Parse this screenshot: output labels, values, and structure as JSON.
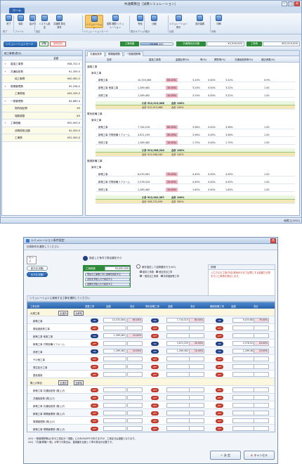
{
  "win1": {
    "title": "共通費算出［試算シミュレーション］",
    "app_tab": "ホーム",
    "ribbon": [
      {
        "label": "終了",
        "icon": "exit-icon"
      },
      {
        "label": "保存",
        "icon": "save-icon"
      },
      {
        "label": "会計事",
        "icon": "accounting-icon"
      },
      {
        "label": "システム設定",
        "icon": "system-settings-icon"
      },
      {
        "label": "共通費\n算出条件",
        "icon": "calc-condition-icon"
      },
      {
        "label": "シミュレーション",
        "icon": "simulation-icon"
      },
      {
        "label": "逆算 期間\nシミュレーション",
        "icon": "reverse-sim-icon"
      },
      {
        "label": "有効",
        "icon": "valid-icon"
      },
      {
        "label": "比較",
        "icon": "compare-icon"
      },
      {
        "label": "シミュレーション条件",
        "icon": "sim-condition-icon"
      },
      {
        "label": "前計金額",
        "icon": "prev-amount-icon"
      },
      {
        "label": "印刷",
        "icon": "print-icon"
      }
    ],
    "ribbon_groups": [
      "終了",
      "ファイル",
      "設定",
      "シミュレーションモード",
      "表示オプション",
      "表示",
      "比較",
      "印刷"
    ],
    "sim_mode_btn": "シミュレーションモード",
    "status_tag1": "試験",
    "status_tag2": "全体合計",
    "labels": {
      "construction": "工事総額",
      "total_common": "共通費総合計額",
      "work_cost": "工事費"
    },
    "values": {
      "construction": "50,000,000",
      "total_common": "¥2,500,000",
      "work_cost": "¥52,510,000"
    },
    "progress_fraction": 0.55,
    "left_title": "総工事費(表示)",
    "left_head": {
      "name": "",
      "amount": "金額"
    },
    "left_rows": [
      {
        "name": "直接工事費",
        "amount": "¥38,722,5",
        "exp": "+",
        "sub": false
      },
      {
        "name": "共通仮設費",
        "amount": "¥1,359,0",
        "exp": "+",
        "sub": false
      },
      {
        "name": "純工事費",
        "amount": "¥40,081,5",
        "exp": "",
        "sub": true
      },
      {
        "name": "現場管理費",
        "amount": "¥5,258,0",
        "exp": "+",
        "sub": false
      },
      {
        "name": "工事原価",
        "amount": "¥45,339,5",
        "exp": "",
        "sub": true
      },
      {
        "name": "一般管理費",
        "amount": "¥4,660,4",
        "exp": "+",
        "sub": false
      },
      {
        "name": "契約保証費",
        "amount": "¥0",
        "exp": "",
        "sub": true
      },
      {
        "name": "端数調整",
        "amount": "-¥0",
        "exp": "",
        "sub": true
      },
      {
        "name": "工事価格",
        "amount": "¥50,000,0",
        "exp": "+",
        "sub": false
      },
      {
        "name": "消費税相当額",
        "amount": "¥2,500,0",
        "exp": "",
        "sub": true
      },
      {
        "name": "工事費",
        "amount": "¥52,500,0",
        "exp": "",
        "sub": true
      }
    ],
    "right_tabs": [
      "共通仮設費",
      "現場管理費",
      "一般管理費等"
    ],
    "grid_headers": [
      "名称",
      "直接工事費",
      "金額比率(%)",
      "率(%)",
      "標準率(%)",
      "共通仮設費率(%)",
      "補正係数(%)"
    ],
    "sections": [
      {
        "title": "道路工事",
        "sub": "案本工事"
      },
      {
        "title": "電気設備工事",
        "sub": "案本工事"
      },
      {
        "title": "機械設備工事",
        "sub": "案本工事"
      }
    ],
    "rows": [
      {
        "name": "新築工事",
        "amount": "10,333,064",
        "ratio": "60.00%",
        "rate": "3.23%",
        "std": "0.00%",
        "common": "3.22%",
        "fix": "0.9%"
      },
      {
        "name": "新築工事 他事工事",
        "amount": "1,289,462",
        "ratio": "10.00%",
        "rate": "3.23%",
        "std": "0.00%",
        "common": "3.22%",
        "fix": "1.00"
      },
      {
        "name": "改修工事",
        "amount": "1,289,462",
        "ratio": "10.00%",
        "rate": "3.23%",
        "std": "0.00%",
        "common": "3.22%",
        "fix": "1.00"
      },
      {
        "name": "新築工事",
        "amount": "7,744,519",
        "ratio": "60.00%",
        "rate": "3.56%",
        "std": "0.00%",
        "common": "3.56%",
        "fix": "1.00"
      },
      {
        "name": "新築工事 付帯設備リフォーム",
        "amount": "3,872,259",
        "ratio": "30.00%",
        "rate": "3.56%",
        "std": "0.00%",
        "common": "3.56%",
        "fix": "1.00"
      },
      {
        "name": "改修工事",
        "amount": "1,289,462",
        "ratio": "10.00%",
        "rate": "1.75%",
        "std": "0.00%",
        "common": "1.75%",
        "fix": "1.00"
      },
      {
        "name": "新築工事",
        "amount": "8,033,061",
        "ratio": "70.00%",
        "rate": "4.45%",
        "std": "0.00%",
        "common": "4.45%",
        "fix": "1.00"
      },
      {
        "name": "新築工事 付帯設備リフォーム",
        "amount": "2,578,524",
        "ratio": "20.00%",
        "rate": "4.45%",
        "std": "0.00%",
        "common": "4.45%",
        "fix": "1.00"
      },
      {
        "name": "改修工事",
        "amount": "1,289,462",
        "ratio": "10.00%",
        "rate": "1.62%",
        "std": "0.00%",
        "common": "1.62%",
        "fix": "1.00"
      }
    ],
    "subtotals": [
      {
        "label": "小計",
        "amount": "¥12,913,988",
        "ratio": "合計 100%"
      },
      {
        "label": "小計",
        "amount": "¥12,906,240",
        "ratio": "合計 100%"
      },
      {
        "label": "小計",
        "amount": "¥12,902,367",
        "ratio": "合計 100%"
      }
    ],
    "totals": [
      {
        "label": "合計",
        "amount": "¥12,913,988",
        "ratio": "合計 100%"
      },
      {
        "label": "合計",
        "amount": "¥12,906,240",
        "ratio": "合計 100%"
      },
      {
        "label": "合計",
        "amount": "¥38,722,595",
        "ratio": "合計 300%"
      }
    ],
    "status_right": "総費工(2012)"
  },
  "win2": {
    "title": "シミュレーション条件設定",
    "subheader": "計算条件を選択してください",
    "mode_label": "モード",
    "mode_btns": [
      "施方法(試験)",
      "全方法(試験)"
    ],
    "instruction": "指定した条件で算出額を行う",
    "green_title": "工事総額",
    "green_value": "50,000,000",
    "opts": [
      "現在の工事費と同じ金額を指定する",
      "割合を手動入力で指定する",
      "金額を手動入力で指定する"
    ],
    "condition_label": "案を指定して逆算額を行う(※1)",
    "checks": [
      "基本工事費",
      "他社担当工事",
      "一般担当工事費",
      "共同施設等工事"
    ],
    "explain_title": "詳細",
    "explain_text": "入力された工事(予定)費用が今まで目標とする金額で計算を行い工事費を算出します。",
    "grid_label": "シミュレーションに使用する工事を選択してください",
    "grid_headers": [
      "工事名称",
      "道路工事",
      "金額",
      "割合",
      "電気設備工事",
      "金額",
      "割合",
      "機械設備工事",
      "金額",
      "割合"
    ],
    "grid_rows": [
      {
        "name": "大規工事",
        "cat": true,
        "p1": "",
        "a1": "",
        "r1": "",
        "p2": "",
        "a2": "",
        "r2": "",
        "p3": "",
        "a3": "",
        "r3": ""
      },
      {
        "name": "新築工事",
        "cat": false,
        "p1": "ON",
        "a1": "10,333,064",
        "r1": "60.00%",
        "p2": "ON",
        "a2": "7,744,519",
        "r2": "60.00%",
        "p3": "ON",
        "a3": "9,033,681",
        "r3": "70.00%"
      },
      {
        "name": "原仮施設費工事",
        "cat": false,
        "p1": "OFF",
        "a1": "",
        "r1": "",
        "p2": "OFF",
        "a2": "",
        "r2": "",
        "p3": "OFF",
        "a3": "",
        "r3": ""
      },
      {
        "name": "新築工事 他事工事",
        "cat": false,
        "p1": "ON",
        "a1": "1,289,462",
        "r1": "10.00%",
        "p2": "OFF",
        "a2": "",
        "r2": "",
        "p3": "OFF",
        "a3": "",
        "r3": ""
      },
      {
        "name": "新築工事 付帯設備リフォーム",
        "cat": false,
        "p1": "OFF",
        "a1": "",
        "r1": "",
        "p2": "ON",
        "a2": "3,872,259",
        "r2": "30.00%",
        "p3": "ON",
        "a3": "2,578,524",
        "r3": "20.00%"
      },
      {
        "name": "改修工事",
        "cat": false,
        "p1": "ON",
        "a1": "1,289,462",
        "r1": "10.00%",
        "p2": "ON",
        "a2": "1,289,462",
        "r2": "10.00%",
        "p3": "ON",
        "a3": "1,289,462",
        "r3": "10.00%"
      },
      {
        "name": "その他工事",
        "cat": false,
        "p1": "OFF",
        "a1": "",
        "r1": "",
        "p2": "OFF",
        "a2": "",
        "r2": "",
        "p3": "OFF",
        "a3": "",
        "r3": ""
      },
      {
        "name": "発生処分工事",
        "cat": false,
        "p1": "OFF",
        "a1": "",
        "r1": "",
        "p2": "OFF",
        "a2": "",
        "r2": "",
        "p3": "OFF",
        "a3": "",
        "r3": ""
      },
      {
        "name": "直仮施設",
        "cat": false,
        "p1": "OFF",
        "a1": "",
        "r1": "",
        "p2": "OFF",
        "a2": "",
        "r2": "",
        "p3": "OFF",
        "a3": "",
        "r3": ""
      },
      {
        "name": "購上げ費目",
        "cat": true,
        "p1": "",
        "a1": "",
        "r1": "",
        "p2": "",
        "a2": "",
        "r2": "",
        "p3": "",
        "a3": "",
        "r3": ""
      },
      {
        "name": "新築工事 共通仮設費 (購上げ)",
        "cat": false,
        "p1": "OFF",
        "a1": "",
        "r1": "",
        "p2": "OFF",
        "a2": "",
        "r2": "",
        "p3": "OFF",
        "a3": "",
        "r3": ""
      },
      {
        "name": "共通仮設費 (購上げ)",
        "cat": false,
        "p1": "OFF",
        "a1": "",
        "r1": "",
        "p2": "OFF",
        "a2": "",
        "r2": "",
        "p3": "OFF",
        "a3": "",
        "r3": ""
      },
      {
        "name": "新築工事 共通仮設費 (購上げ)",
        "cat": false,
        "p1": "OFF",
        "a1": "",
        "r1": "",
        "p2": "OFF",
        "a2": "",
        "r2": "",
        "p3": "OFF",
        "a3": "",
        "r3": ""
      },
      {
        "name": "新築工事 現場管理費 (購上げ)",
        "cat": false,
        "p1": "OFF",
        "a1": "",
        "r1": "",
        "p2": "OFF",
        "a2": "",
        "r2": "",
        "p3": "OFF",
        "a3": "",
        "r3": ""
      },
      {
        "name": "現場管理費 (購上げ)",
        "cat": false,
        "p1": "OFF",
        "a1": "",
        "r1": "",
        "p2": "OFF",
        "a2": "",
        "r2": "",
        "p3": "OFF",
        "a3": "",
        "r3": ""
      },
      {
        "name": "新築工事 現場管理費 (購上げ)",
        "cat": false,
        "p1": "OFF",
        "a1": "",
        "r1": "",
        "p2": "OFF",
        "a2": "",
        "r2": "",
        "p3": "OFF",
        "a3": "",
        "r3": ""
      },
      {
        "name": "一般管理費 (購上げ) (※1)",
        "cat": false,
        "p1": "OFF",
        "a1": "",
        "r1": "",
        "p2": "OFF",
        "a2": "",
        "r2": "",
        "p3": "OFF",
        "a3": "",
        "r3": ""
      }
    ],
    "select_all": "全選択",
    "deselect_all": "全解除",
    "footnotes": [
      "(※1) 一般管理費等は1件の工事区分「道路」にのみON/OFFがありますが、工事区分は連動となります。",
      "(※2) 「共通/現場/一般」の率での算出は、直接額を比較して率の算出が必要です。"
    ],
    "ok_label": "決 定",
    "cancel_label": "キャンセル"
  }
}
